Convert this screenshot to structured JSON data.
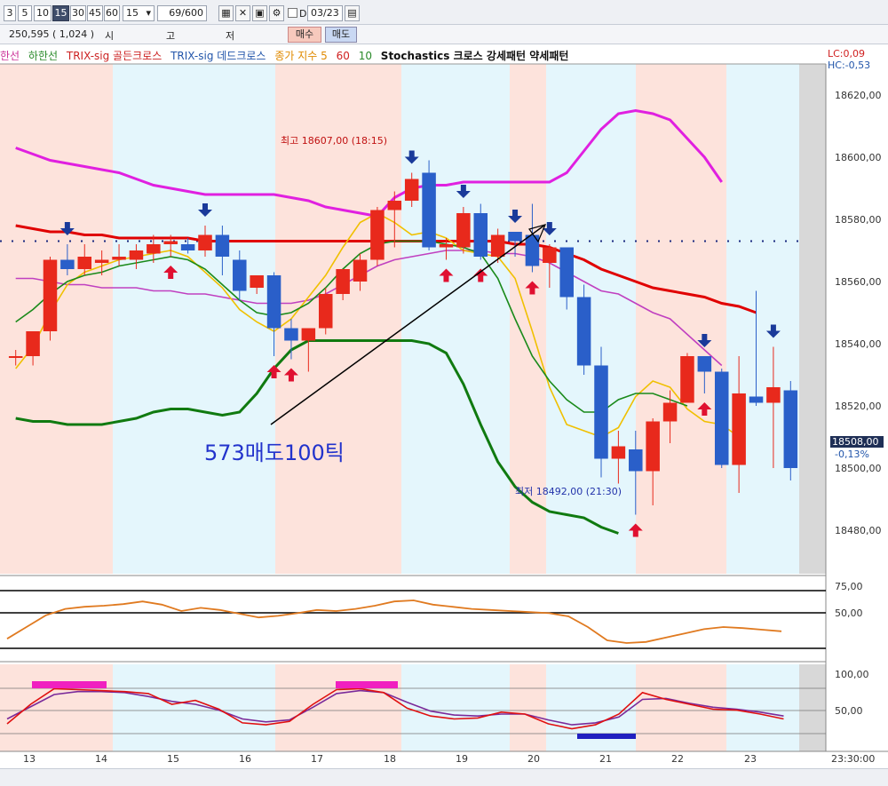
{
  "toolbar": {
    "periods": [
      "3",
      "5",
      "10",
      "15",
      "30",
      "45",
      "60"
    ],
    "active_period": "15",
    "interval_value": "15",
    "count_value": "69/600",
    "checkbox_label": "D",
    "date_value": "03/23"
  },
  "quote_bar": {
    "volume": "250,595 ( 1,024 )",
    "label_si": "시",
    "label_go": "고",
    "label_jeo": "저",
    "buy_label": "매수",
    "sell_label": "매도"
  },
  "legend": {
    "items": [
      {
        "text": "한선",
        "color": "#cc3399"
      },
      {
        "text": "하한선",
        "color": "#2a8a2a"
      },
      {
        "text": "TRIX-sig 골든크로스",
        "color": "#cc2222"
      },
      {
        "text": "TRIX-sig 데드크로스",
        "color": "#2255aa"
      },
      {
        "text": "종가 지수 5",
        "color": "#e08a00"
      },
      {
        "text": "60",
        "color": "#d02020"
      },
      {
        "text": "10",
        "color": "#2a8a2a"
      },
      {
        "text": "Stochastics 크로스 강세패턴  약세패턴",
        "color": "#111111"
      }
    ],
    "lc": "LC:0,09",
    "hc": "HC:-0,53"
  },
  "price_axis": [
    "18620,00",
    "18600,00",
    "18580,00",
    "18560,00",
    "18540,00",
    "18520,00",
    "18500,00",
    "18480,00"
  ],
  "current_price": "18508,00",
  "current_change": "-0,13%",
  "osc1_axis": [
    "75,00",
    "50,00"
  ],
  "osc2_axis": [
    "100,00",
    "50,00"
  ],
  "x_axis": [
    "13",
    "14",
    "15",
    "16",
    "17",
    "18",
    "19",
    "20",
    "21",
    "22",
    "23"
  ],
  "x_axis_time": "23:30:00",
  "annotations": {
    "high": "최고 18607,00 (18:15)",
    "low": "최저 18492,00 (21:30)",
    "big_text": "573매도100틱"
  },
  "chart_data": {
    "type": "candlestick",
    "ylim": [
      18474,
      18638
    ],
    "candles": [
      {
        "o": 18544,
        "h": 18546,
        "l": 18541,
        "c": 18544
      },
      {
        "o": 18544,
        "h": 18552,
        "l": 18541,
        "c": 18552
      },
      {
        "o": 18552,
        "h": 18576,
        "l": 18549,
        "c": 18575
      },
      {
        "o": 18575,
        "h": 18580,
        "l": 18570,
        "c": 18572
      },
      {
        "o": 18572,
        "h": 18580,
        "l": 18570,
        "c": 18576
      },
      {
        "o": 18574,
        "h": 18578,
        "l": 18570,
        "c": 18575
      },
      {
        "o": 18575,
        "h": 18580,
        "l": 18573,
        "c": 18576
      },
      {
        "o": 18575,
        "h": 18580,
        "l": 18572,
        "c": 18578
      },
      {
        "o": 18577,
        "h": 18583,
        "l": 18574,
        "c": 18580
      },
      {
        "o": 18580,
        "h": 18583,
        "l": 18576,
        "c": 18581
      },
      {
        "o": 18580,
        "h": 18582,
        "l": 18577,
        "c": 18578
      },
      {
        "o": 18578,
        "h": 18586,
        "l": 18576,
        "c": 18583
      },
      {
        "o": 18583,
        "h": 18586,
        "l": 18570,
        "c": 18576
      },
      {
        "o": 18575,
        "h": 18578,
        "l": 18562,
        "c": 18565
      },
      {
        "o": 18566,
        "h": 18570,
        "l": 18564,
        "c": 18570
      },
      {
        "o": 18570,
        "h": 18571,
        "l": 18544,
        "c": 18553
      },
      {
        "o": 18553,
        "h": 18556,
        "l": 18543,
        "c": 18549
      },
      {
        "o": 18549,
        "h": 18553,
        "l": 18539,
        "c": 18553
      },
      {
        "o": 18553,
        "h": 18566,
        "l": 18551,
        "c": 18564
      },
      {
        "o": 18564,
        "h": 18572,
        "l": 18562,
        "c": 18572
      },
      {
        "o": 18568,
        "h": 18577,
        "l": 18565,
        "c": 18575
      },
      {
        "o": 18575,
        "h": 18592,
        "l": 18573,
        "c": 18591
      },
      {
        "o": 18591,
        "h": 18597,
        "l": 18579,
        "c": 18594
      },
      {
        "o": 18594,
        "h": 18603,
        "l": 18592,
        "c": 18601
      },
      {
        "o": 18603,
        "h": 18607,
        "l": 18578,
        "c": 18579
      },
      {
        "o": 18579,
        "h": 18582,
        "l": 18575,
        "c": 18580
      },
      {
        "o": 18579,
        "h": 18592,
        "l": 18577,
        "c": 18590
      },
      {
        "o": 18590,
        "h": 18593,
        "l": 18575,
        "c": 18576
      },
      {
        "o": 18576,
        "h": 18585,
        "l": 18574,
        "c": 18583
      },
      {
        "o": 18584,
        "h": 18584,
        "l": 18576,
        "c": 18581
      },
      {
        "o": 18583,
        "h": 18593,
        "l": 18571,
        "c": 18573
      },
      {
        "o": 18574,
        "h": 18580,
        "l": 18566,
        "c": 18579
      },
      {
        "o": 18579,
        "h": 18579,
        "l": 18559,
        "c": 18563
      },
      {
        "o": 18563,
        "h": 18567,
        "l": 18538,
        "c": 18541
      },
      {
        "o": 18541,
        "h": 18547,
        "l": 18505,
        "c": 18511
      },
      {
        "o": 18511,
        "h": 18520,
        "l": 18503,
        "c": 18515
      },
      {
        "o": 18514,
        "h": 18520,
        "l": 18493,
        "c": 18507
      },
      {
        "o": 18507,
        "h": 18524,
        "l": 18496,
        "c": 18523
      },
      {
        "o": 18523,
        "h": 18533,
        "l": 18516,
        "c": 18529
      },
      {
        "o": 18529,
        "h": 18545,
        "l": 18529,
        "c": 18544
      },
      {
        "o": 18544,
        "h": 18544,
        "l": 18532,
        "c": 18539
      },
      {
        "o": 18539,
        "h": 18540,
        "l": 18508,
        "c": 18509
      },
      {
        "o": 18509,
        "h": 18544,
        "l": 18500,
        "c": 18532
      },
      {
        "o": 18531,
        "h": 18565,
        "l": 18528,
        "c": 18529
      },
      {
        "o": 18529,
        "h": 18547,
        "l": 18508,
        "c": 18534
      },
      {
        "o": 18533,
        "h": 18536,
        "l": 18504,
        "c": 18508
      }
    ],
    "series": [
      {
        "color": "#e020e0",
        "values": [
          18611,
          18609,
          18607,
          18606,
          18605,
          18604,
          18603,
          18601,
          18599,
          18598,
          18597,
          18596,
          18596,
          18596,
          18596,
          18596,
          18595,
          18594,
          18592,
          18591,
          18590,
          18589,
          18595,
          18598,
          18599,
          18599,
          18600,
          18600,
          18600,
          18600,
          18600,
          18600,
          18603,
          18610,
          18617,
          18622,
          18623,
          18622,
          18620,
          18614,
          18608,
          18600
        ]
      },
      {
        "color": "#e00000",
        "values": [
          18586,
          18585,
          18584,
          18584,
          18583,
          18583,
          18582,
          18582,
          18582,
          18582,
          18582,
          18581,
          18581,
          18581,
          18581,
          18581,
          18581,
          18581,
          18581,
          18581,
          18581,
          18581,
          18581,
          18581,
          18581,
          18581,
          18581,
          18581,
          18581,
          18580,
          18580,
          18579,
          18577,
          18575,
          18572,
          18570,
          18568,
          18566,
          18565,
          18564,
          18563,
          18561,
          18560,
          18558
        ]
      },
      {
        "color": "#c040c0",
        "values": [
          18569,
          18569,
          18568,
          18567,
          18567,
          18566,
          18566,
          18566,
          18565,
          18565,
          18564,
          18564,
          18563,
          18562,
          18561,
          18561,
          18561,
          18562,
          18564,
          18567,
          18570,
          18573,
          18575,
          18576,
          18577,
          18578,
          18578,
          18578,
          18577,
          18577,
          18576,
          18574,
          18571,
          18568,
          18565,
          18564,
          18561,
          18558,
          18556,
          18551,
          18546,
          18541
        ]
      },
      {
        "color": "#f0c000",
        "values": [
          18540,
          18547,
          18558,
          18567,
          18571,
          18573,
          18575,
          18576,
          18577,
          18578,
          18576,
          18571,
          18566,
          18559,
          18555,
          18552,
          18556,
          18563,
          18570,
          18579,
          18587,
          18590,
          18587,
          18583,
          18584,
          18582,
          18578,
          18577,
          18576,
          18569,
          18552,
          18534,
          18522,
          18520,
          18518,
          18521,
          18531,
          18536,
          18534,
          18527,
          18523,
          18522,
          18518
        ]
      },
      {
        "color": "#1a8a1a",
        "values": [
          18555,
          18559,
          18564,
          18568,
          18570,
          18571,
          18573,
          18574,
          18575,
          18576,
          18575,
          18572,
          18567,
          18562,
          18558,
          18557,
          18558,
          18561,
          18566,
          18572,
          18577,
          18580,
          18581,
          18581,
          18581,
          18580,
          18579,
          18577,
          18569,
          18556,
          18544,
          18536,
          18530,
          18526,
          18526,
          18530,
          18532,
          18532,
          18530,
          18528
        ]
      },
      {
        "color": "#107a10",
        "values": [
          18524,
          18523,
          18523,
          18522,
          18522,
          18522,
          18523,
          18524,
          18526,
          18527,
          18527,
          18526,
          18525,
          18526,
          18532,
          18540,
          18546,
          18549,
          18549,
          18549,
          18549,
          18549,
          18549,
          18549,
          18548,
          18545,
          18535,
          18522,
          18510,
          18502,
          18497,
          18494,
          18493,
          18492,
          18489,
          18487
        ]
      }
    ],
    "buy_signals": [
      16,
      9,
      15,
      25,
      27,
      30,
      36,
      40
    ],
    "sell_signals": [
      3,
      11,
      23,
      26,
      29,
      31,
      40,
      44
    ]
  }
}
